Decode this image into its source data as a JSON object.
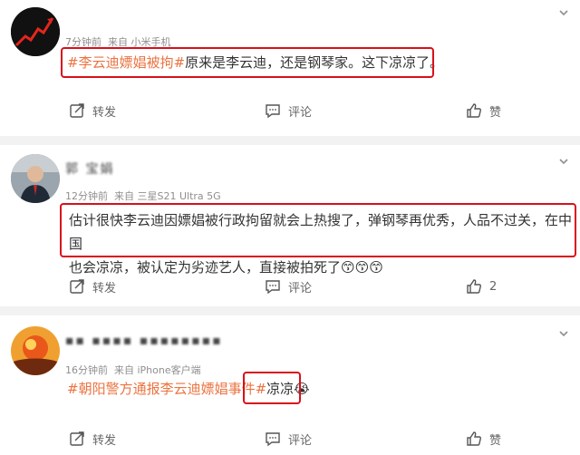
{
  "posts": [
    {
      "time": "7分钟前",
      "source": "来自 小米手机",
      "tag": "#李云迪嫖娼被拘#",
      "text": "原来是李云迪，还是钢琴家。这下凉凉了。",
      "actions": {
        "repost": "转发",
        "comment": "评论",
        "like": "赞"
      }
    },
    {
      "name": "郭     宝娟",
      "time": "12分钟前",
      "source": "来自 三星S21 Ultra 5G",
      "text_line1": "估计很快李云迪因嫖娼被行政拘留就会上热搜了，弹钢琴再优秀，人品不过关，在中国",
      "text_line2": "也会凉凉，被认定为劣迹艺人，直接被拍死了",
      "emoji": "😙😙😙",
      "actions": {
        "repost": "转发",
        "comment": "评论",
        "like_count": "2"
      }
    },
    {
      "name": "▪▪ ▪▪▪▪ ▪▪▪▪▪▪▪▪",
      "time": "16分钟前",
      "source": "来自 iPhone客户端",
      "tag": "#朝阳警方通报李云迪嫖娼事件#",
      "text": "凉凉",
      "emoji": "😭",
      "actions": {
        "repost": "转发",
        "comment": "评论",
        "like": "赞"
      }
    }
  ],
  "colors": {
    "tag": "#eb7340",
    "highlight_box": "#d8101a",
    "separator": "#f2f2f2"
  }
}
